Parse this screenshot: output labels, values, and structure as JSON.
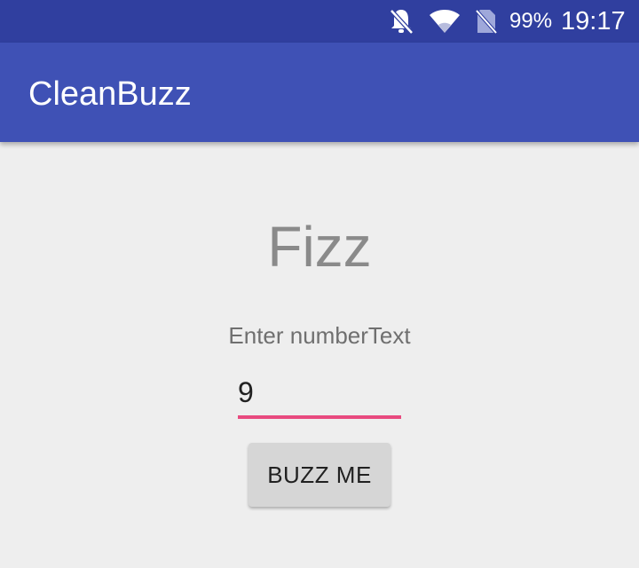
{
  "status_bar": {
    "battery": "99%",
    "time": "19:17",
    "icons": [
      "notifications-off-icon",
      "wifi-icon",
      "no-sim-icon"
    ]
  },
  "app_bar": {
    "title": "CleanBuzz"
  },
  "main": {
    "result": "Fizz",
    "prompt": "Enter numberText",
    "number_input_value": "9",
    "buzz_button_label": "BUZZ ME"
  },
  "colors": {
    "status_bar": "#303f9f",
    "app_bar": "#3f51b5",
    "accent": "#e84a7f",
    "background": "#eeeeee",
    "button": "#d6d6d6"
  }
}
